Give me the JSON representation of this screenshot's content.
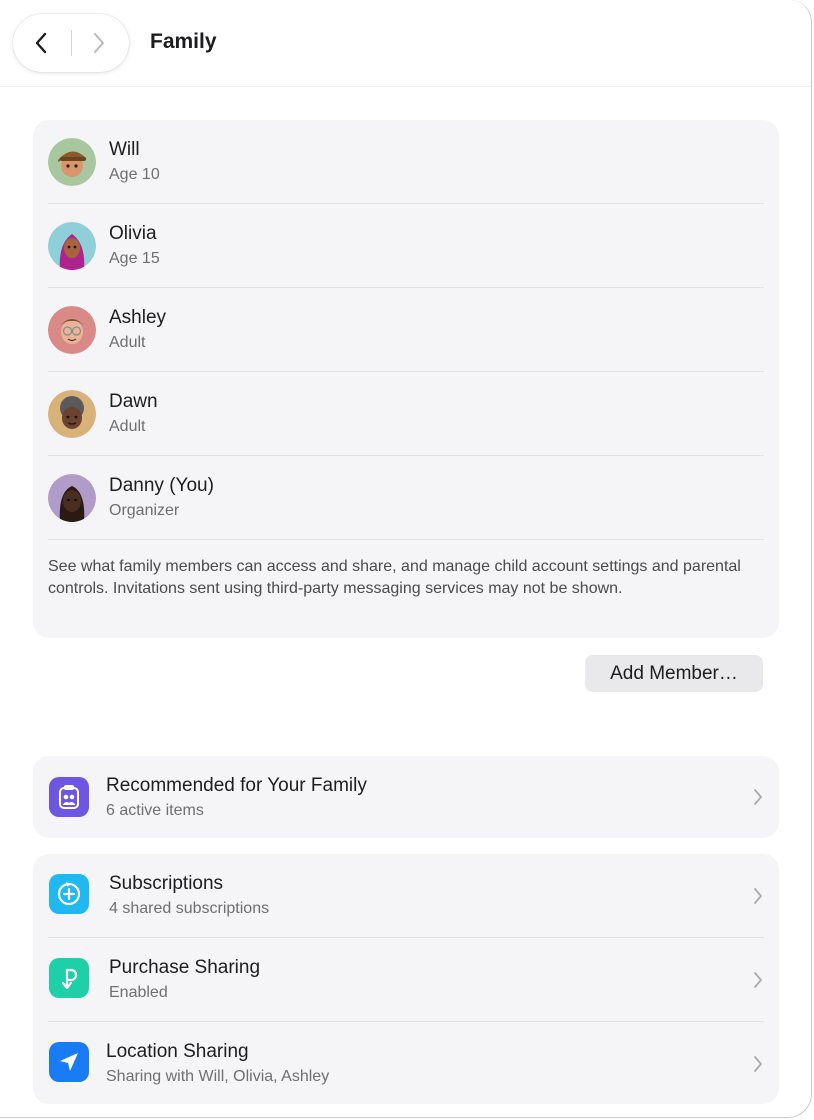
{
  "toolbar": {
    "title": "Family",
    "back_icon": "chevron-left-icon",
    "forward_icon": "chevron-right-icon"
  },
  "members": [
    {
      "name": "Will",
      "role": "Age 10",
      "avatar_color": "#a9c79f"
    },
    {
      "name": "Olivia",
      "role": "Age 15",
      "avatar_color": "#8fd0d8"
    },
    {
      "name": "Ashley",
      "role": "Adult",
      "avatar_color": "#d98a86"
    },
    {
      "name": "Dawn",
      "role": "Adult",
      "avatar_color": "#d9b27a"
    },
    {
      "name": "Danny (You)",
      "role": "Organizer",
      "avatar_color": "#b19bc9"
    }
  ],
  "note": "See what family members can access and share, and manage child account settings and parental controls. Invitations sent using third-party messaging services may not be shown.",
  "add_member_label": "Add Member…",
  "recommended": {
    "title": "Recommended for Your Family",
    "subtitle": "6 active items",
    "icon": "family-checklist-icon",
    "color": "#6e57e0"
  },
  "services": [
    {
      "title": "Subscriptions",
      "subtitle": "4 shared subscriptions",
      "icon": "subscriptions-icon",
      "color": "#1fb8f0"
    },
    {
      "title": "Purchase Sharing",
      "subtitle": "Enabled",
      "icon": "purchase-sharing-icon",
      "color": "#1fcfa8"
    },
    {
      "title": "Location Sharing",
      "subtitle": "Sharing with Will, Olivia, Ashley",
      "icon": "location-arrow-icon",
      "color": "#1a7cf5"
    }
  ]
}
